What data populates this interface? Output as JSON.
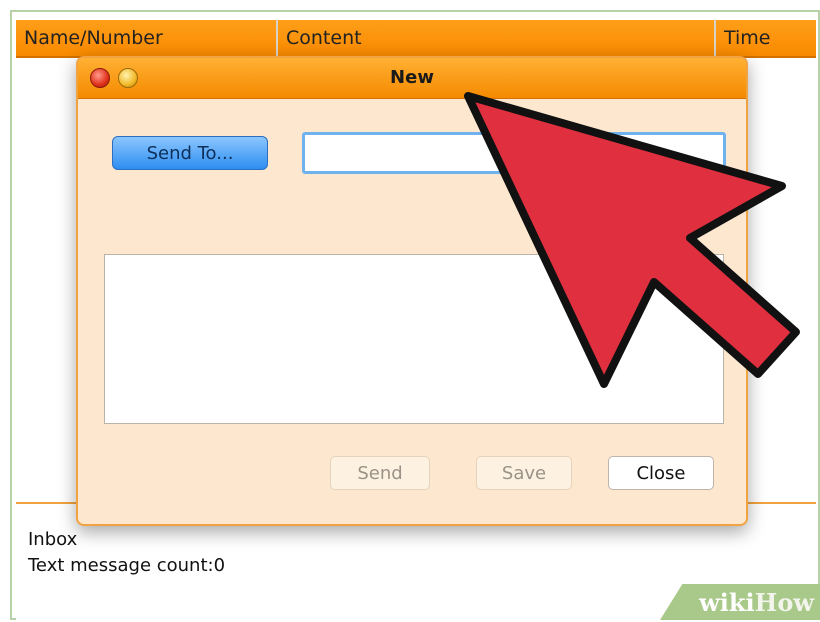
{
  "table": {
    "columns": [
      "Name/Number",
      "Content",
      "Time"
    ]
  },
  "status": {
    "inbox": "Inbox",
    "count": "Text message count:0"
  },
  "dialog": {
    "title": "New",
    "send_to_label": "Send To...",
    "recipient_value": "",
    "message_value": "",
    "buttons": {
      "send": "Send",
      "save": "Save",
      "close": "Close"
    }
  },
  "watermark": {
    "wiki": "wiki",
    "how": "How"
  },
  "colors": {
    "header_orange": "#f98a00",
    "dialog_bg": "#fde8cf",
    "send_to_blue": "#2d8ef0",
    "arrow_red": "#e0303f"
  },
  "icons": [
    "close-window-icon",
    "minimize-window-icon",
    "pointer-arrow-icon"
  ]
}
